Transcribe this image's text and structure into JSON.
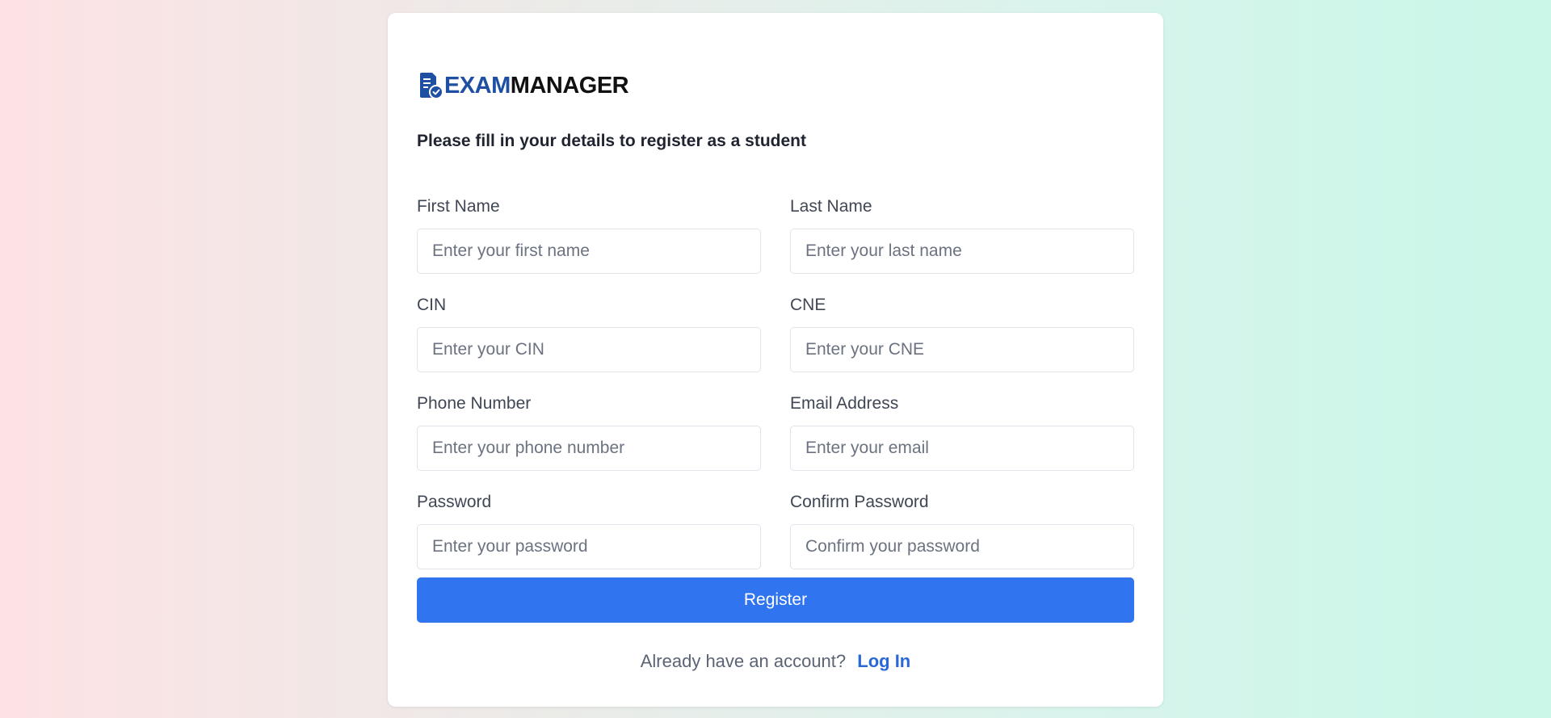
{
  "brand": {
    "name_part1": "EXAM",
    "name_part2": "MANAGER",
    "primary_color": "#1e4fa3",
    "icon": "document-check-icon"
  },
  "subtitle": "Please fill in your details to register as a student",
  "form": {
    "fields": [
      {
        "label": "First Name",
        "placeholder": "Enter your first name",
        "value": ""
      },
      {
        "label": "Last Name",
        "placeholder": "Enter your last name",
        "value": ""
      },
      {
        "label": "CIN",
        "placeholder": "Enter your CIN",
        "value": ""
      },
      {
        "label": "CNE",
        "placeholder": "Enter your CNE",
        "value": ""
      },
      {
        "label": "Phone Number",
        "placeholder": "Enter your phone number",
        "value": ""
      },
      {
        "label": "Email Address",
        "placeholder": "Enter your email",
        "value": ""
      },
      {
        "label": "Password",
        "placeholder": "Enter your password",
        "value": ""
      },
      {
        "label": "Confirm Password",
        "placeholder": "Confirm your password",
        "value": ""
      }
    ],
    "submit_label": "Register",
    "button_color": "#3174ef"
  },
  "footer": {
    "prompt": "Already have an account?",
    "link_label": "Log In"
  }
}
